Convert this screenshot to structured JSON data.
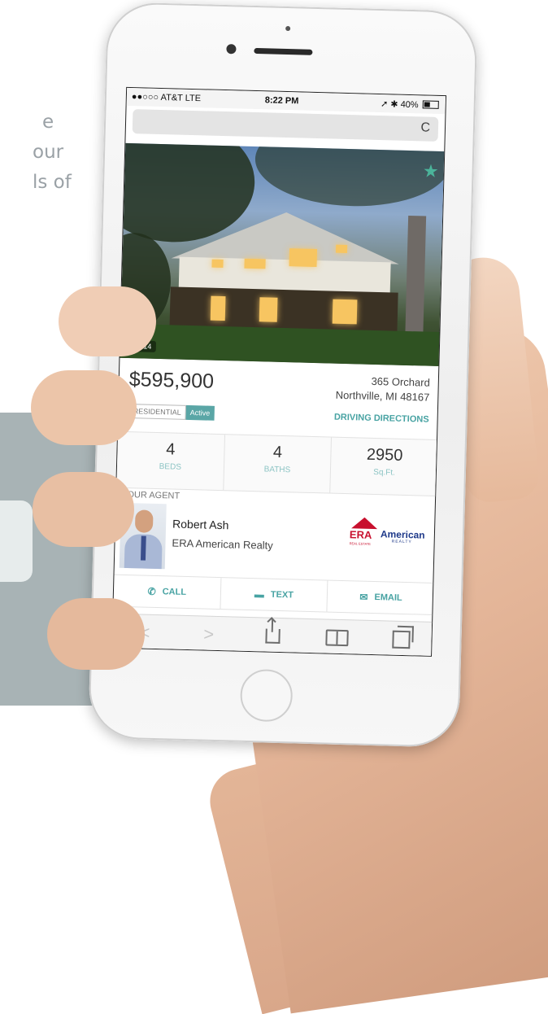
{
  "background": {
    "text_lines": [
      "e",
      "our",
      "ls of"
    ]
  },
  "status_bar": {
    "carrier": "●●○○○ AT&T  LTE",
    "time": "8:22 PM",
    "battery": "40%",
    "status_icons": "➚ ✱"
  },
  "browser": {
    "reload_icon": "C"
  },
  "listing": {
    "photo_counter": "1 of 14",
    "price": "$595,900",
    "address_line1": "365 Orchard",
    "address_line2": "Northville, MI 48167",
    "type_tag": "RESIDENTIAL",
    "status_tag": "Active",
    "directions_label": "DRIVING DIRECTIONS",
    "stats": [
      {
        "value": "4",
        "label": "BEDS"
      },
      {
        "value": "4",
        "label": "BATHS"
      },
      {
        "value": "2950",
        "label": "Sq.Ft."
      }
    ]
  },
  "agent": {
    "heading": "YOUR AGENT",
    "name": "Robert Ash",
    "company": "ERA American Realty",
    "logo_era": "ERA",
    "logo_era_sub": "REAL ESTATE",
    "logo_american": "American",
    "logo_realty": "REALTY"
  },
  "actions": {
    "call": "CALL",
    "text": "TEXT",
    "email": "EMAIL"
  },
  "toolbar": {
    "back": "<",
    "forward": ">"
  }
}
